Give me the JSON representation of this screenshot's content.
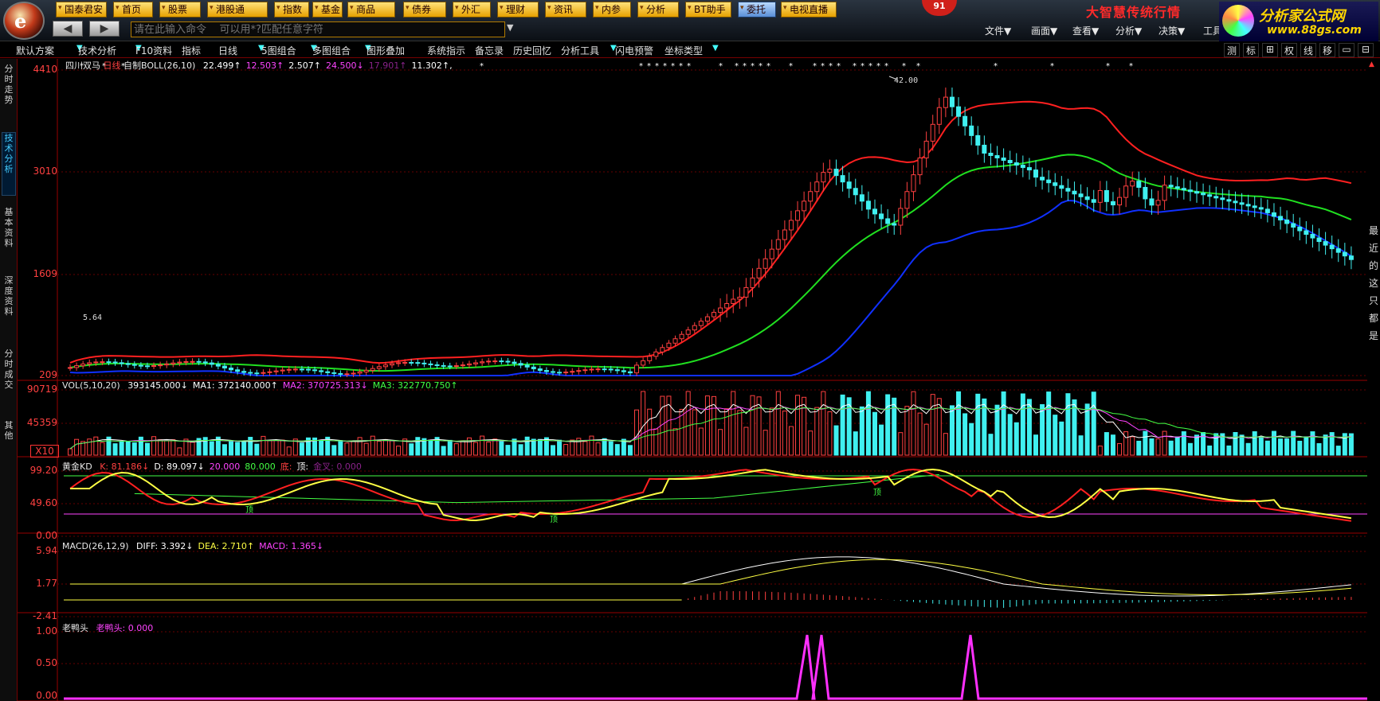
{
  "nav_buttons": [
    "国泰君安",
    "首页",
    "股票",
    "港股通",
    "指数",
    "基金",
    "商品",
    "债券",
    "外汇",
    "理财",
    "资讯",
    "内参",
    "分析",
    "BT助手",
    "委托",
    "电视直播"
  ],
  "badge": "91",
  "app_title": "大智慧传统行情",
  "command_placeholder": "请在此输入命令    可以用*?匹配任意字符",
  "menus": [
    "文件▼",
    "画面▼",
    "查看▼",
    "分析▼",
    "决策▼",
    "工具"
  ],
  "brand": {
    "name": "分析家公式网",
    "url": "www.88gs.com"
  },
  "toolbar": [
    "默认方案",
    "技术分析",
    "F10资料",
    "指标",
    "日线",
    "5图组合",
    "多图组合",
    "图形叠加",
    "系统指示",
    "备忘录",
    "历史回忆",
    "分析工具",
    "闪电预警",
    "坐标类型"
  ],
  "right_tools": [
    "测",
    "标",
    "⊞",
    "权",
    "线",
    "移",
    "▭",
    "⊟"
  ],
  "left_tabs": [
    "分时走势",
    "技术分析",
    "基本资料",
    "深度资料",
    "分时成交",
    "其他"
  ],
  "right_strip_text": "最近的这只都是",
  "main": {
    "stock": "四川双马",
    "period": "日线",
    "indicator": "自制BOLL(26,10)",
    "values": [
      {
        "text": "22.499↑",
        "color": "#ffffff"
      },
      {
        "text": "12.503↑",
        "color": "#ff44ff"
      },
      {
        "text": "2.507↑",
        "color": "#ffffff"
      },
      {
        "text": "24.500↓",
        "color": "#ff44ff"
      },
      {
        "text": "17.901↑",
        "color": "#882288"
      },
      {
        "text": "11.302↑,",
        "color": "#ffffff"
      }
    ],
    "y_ticks": [
      "4410",
      "3010",
      "1609",
      "209"
    ],
    "peak_label": "42.00",
    "low_label": "5.64"
  },
  "vol": {
    "title": "VOL(5,10,20)",
    "values": [
      {
        "text": "393145.000↓",
        "color": "#ffffff"
      },
      {
        "text": "MA1: 372140.000↑",
        "color": "#ffffff"
      },
      {
        "text": "MA2: 370725.313↓",
        "color": "#ff44ff"
      },
      {
        "text": "MA3: 322770.750↑",
        "color": "#44ff44"
      }
    ],
    "y_ticks": [
      "90719",
      "45359"
    ],
    "unit": "X10"
  },
  "kd": {
    "title": "黄金KD",
    "values": [
      {
        "text": "K: 81.186↓",
        "color": "#ff4040"
      },
      {
        "text": "D: 89.097↓",
        "color": "#ffffff"
      },
      {
        "text": "20.000",
        "color": "#ff44ff"
      },
      {
        "text": "80.000",
        "color": "#44ff44"
      },
      {
        "text": "底:",
        "color": "#ff4040"
      },
      {
        "text": "顶:",
        "color": "#ffffff"
      },
      {
        "text": "金叉: 0.000",
        "color": "#882288"
      }
    ],
    "y_ticks": [
      "99.20",
      "49.60",
      "0.00"
    ],
    "markers": [
      "顶",
      "顶",
      "顶"
    ]
  },
  "macd": {
    "title": "MACD(26,12,9)",
    "values": [
      {
        "text": "DIFF: 3.392↓",
        "color": "#ffffff"
      },
      {
        "text": "DEA: 2.710↑",
        "color": "#ffff44"
      },
      {
        "text": "MACD: 1.365↓",
        "color": "#ff44ff"
      }
    ],
    "y_ticks": [
      "5.94",
      "1.77",
      "-2.41"
    ]
  },
  "ldt": {
    "title": "老鸭头",
    "values": [
      {
        "text": "老鸭头: 0.000",
        "color": "#ff44ff"
      }
    ],
    "y_ticks": [
      "1.00",
      "0.50",
      "0.00"
    ]
  }
}
